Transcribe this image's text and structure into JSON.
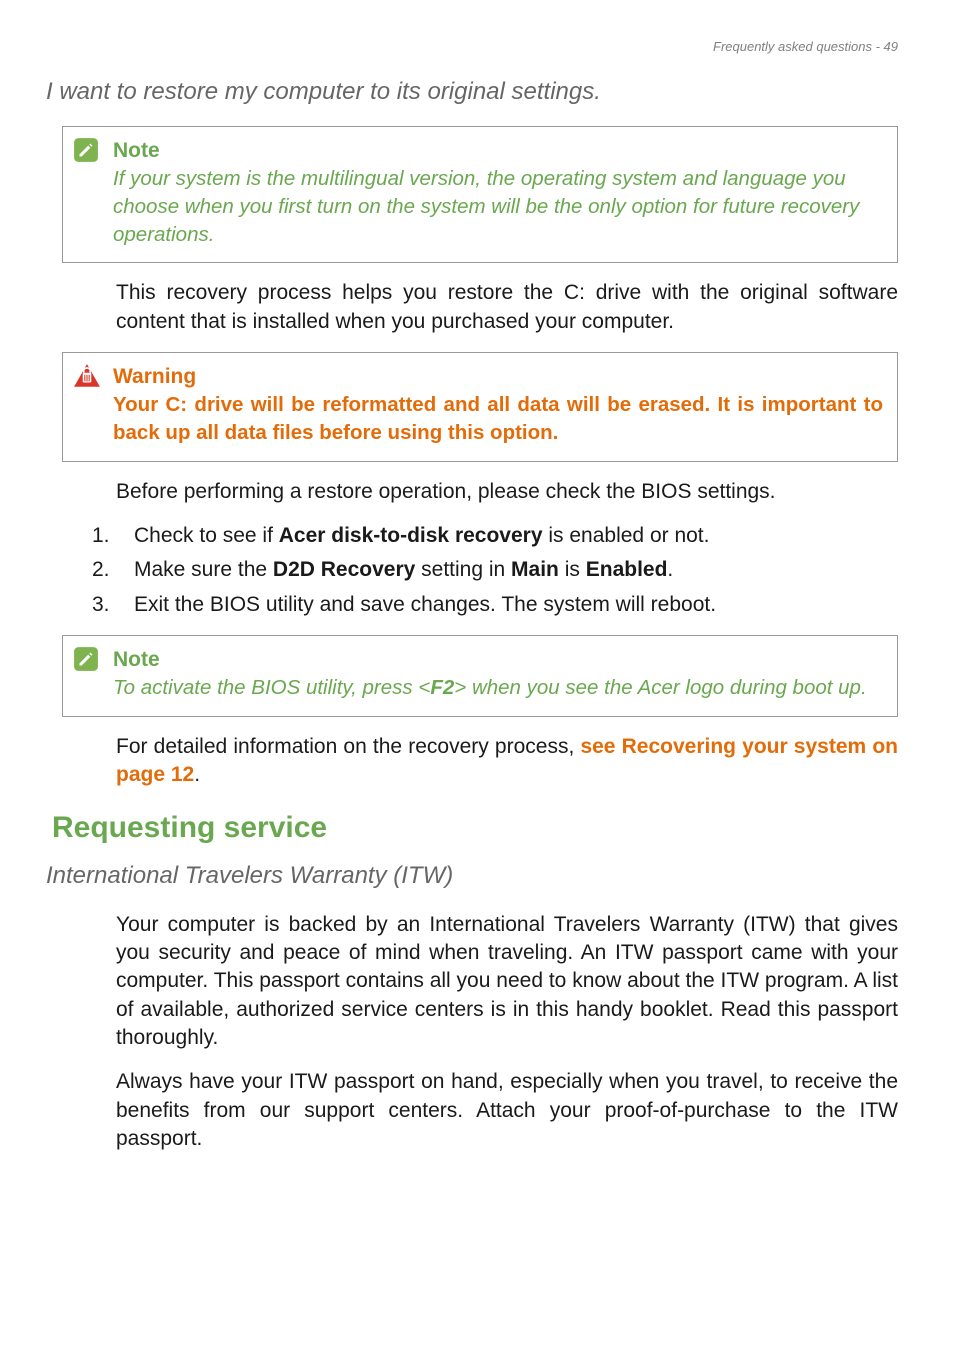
{
  "header": {
    "breadcrumb": "Frequently asked questions - 49"
  },
  "section1": {
    "heading": "I want to restore my computer to its original settings.",
    "note1": {
      "title": "Note",
      "body": "If your system is the multilingual version, the operating system and language you choose when you first turn on the system will be the only option for future recovery operations."
    },
    "para1": "This recovery process helps you restore the C: drive with the original software content that is installed when you purchased your computer.",
    "warning": {
      "title": "Warning",
      "body": "Your C: drive will be reformatted and all data will be erased. It is important to back up all data files before using this option."
    },
    "para2": "Before performing a restore operation, please check the BIOS settings.",
    "list": {
      "item1_pre": "Check to see if ",
      "item1_bold": "Acer disk-to-disk recovery",
      "item1_post": " is enabled or not.",
      "item2_pre": "Make sure the ",
      "item2_bold1": "D2D Recovery",
      "item2_mid": " setting in ",
      "item2_bold2": "Main",
      "item2_mid2": " is ",
      "item2_bold3": "Enabled",
      "item2_post": ".",
      "item3": "Exit the BIOS utility and save changes. The system will reboot."
    },
    "note2": {
      "title": "Note",
      "body_pre": "To activate the BIOS utility, press <",
      "body_key": "F2",
      "body_post": "> when you see the Acer logo during boot up."
    },
    "para3_pre": "For detailed information on the recovery process, ",
    "para3_link": "see Recovering your system on page 12",
    "para3_post": "."
  },
  "section2": {
    "heading": "Requesting service",
    "subheading": "International Travelers Warranty (ITW)",
    "para1": "Your computer is backed by an International Travelers Warranty (ITW) that gives you security and peace of mind when traveling. An ITW passport came with your computer. This passport contains all you need to know about the ITW program. A list of available, authorized service centers is in this handy booklet. Read this passport thoroughly.",
    "para2": "Always have your ITW passport on hand, especially when you travel, to receive the benefits from our support centers. Attach your proof-of-purchase to the ITW passport."
  },
  "numbers": {
    "n1": "1.",
    "n2": "2.",
    "n3": "3."
  }
}
